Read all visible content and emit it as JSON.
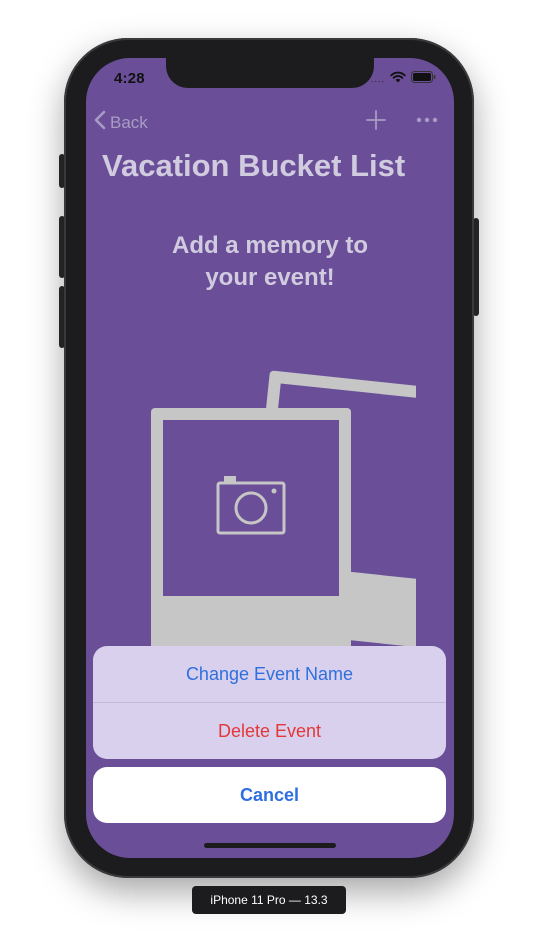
{
  "status_bar": {
    "time": "4:28",
    "signal": "....",
    "icons": [
      "wifi-icon",
      "battery-icon"
    ]
  },
  "nav": {
    "back_label": "Back",
    "icons": [
      "chevron-left-icon",
      "plus-icon",
      "more-icon"
    ]
  },
  "page": {
    "title": "Vacation Bucket List",
    "prompt_line1": "Add a memory to",
    "prompt_line2": "your event!",
    "illustration_icon": "camera-icon"
  },
  "action_sheet": {
    "items": [
      {
        "label": "Change Event Name",
        "style": "default"
      },
      {
        "label": "Delete Event",
        "style": "destructive"
      }
    ],
    "cancel_label": "Cancel"
  },
  "device_label": "iPhone 11 Pro — 13.3",
  "colors": {
    "screen_background": "#6a4f98",
    "title_text": "#d1cbe0",
    "action_blue": "#2f6fe0",
    "destructive_red": "#e3383b",
    "sheet_background": "#d8d0ec",
    "photo_frame": "#c6c6c6"
  }
}
